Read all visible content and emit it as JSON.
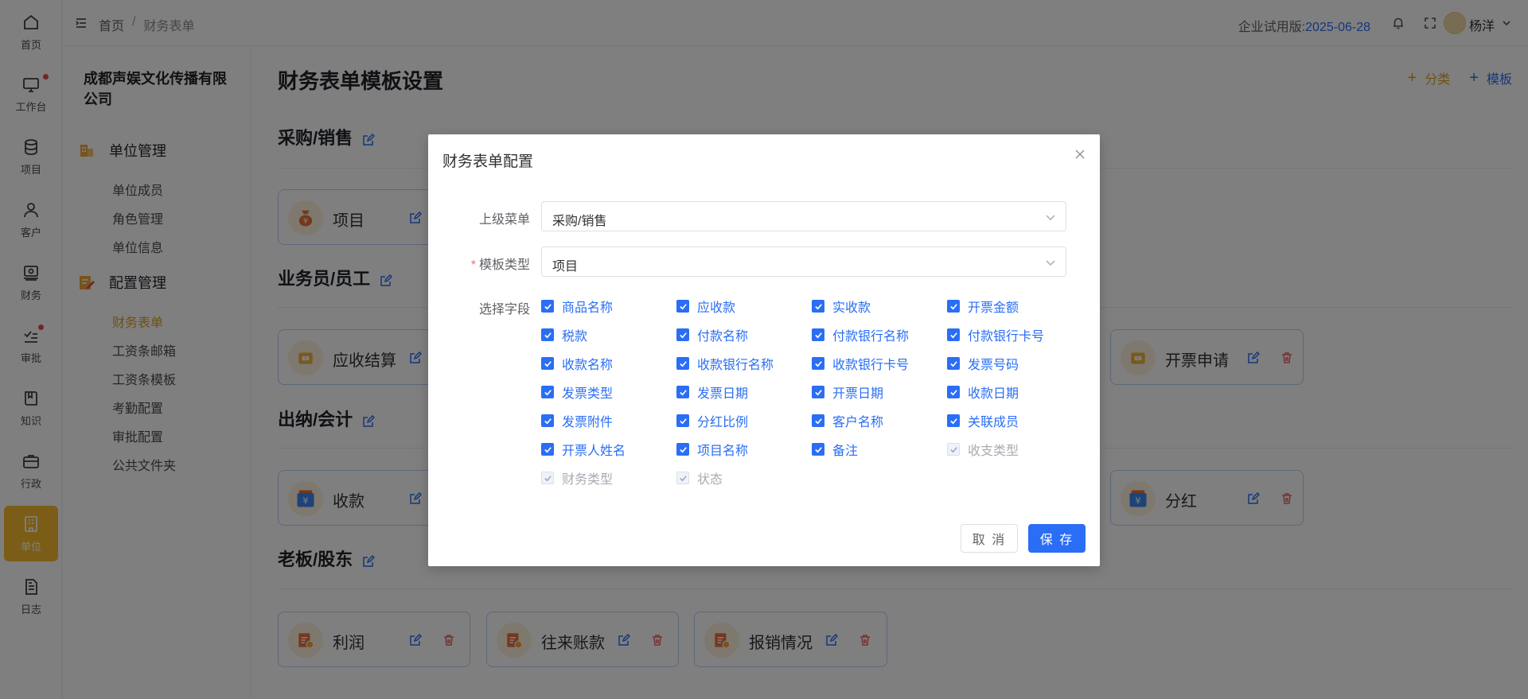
{
  "rail": [
    {
      "label": "首页",
      "icon": "home-icon"
    },
    {
      "label": "工作台",
      "icon": "monitor-icon",
      "dot": true
    },
    {
      "label": "项目",
      "icon": "database-icon"
    },
    {
      "label": "客户",
      "icon": "user-icon"
    },
    {
      "label": "财务",
      "icon": "finance-icon"
    },
    {
      "label": "审批",
      "icon": "approval-icon",
      "dot": true
    },
    {
      "label": "知识",
      "icon": "book-icon"
    },
    {
      "label": "行政",
      "icon": "briefcase-icon"
    },
    {
      "label": "单位",
      "icon": "building-icon",
      "active": true
    },
    {
      "label": "日志",
      "icon": "document-icon"
    }
  ],
  "header": {
    "breadcrumb": [
      "首页",
      "/",
      "财务表单"
    ],
    "trial_label": "企业试用版:",
    "trial_date": "2025-06-28",
    "username": "杨洋"
  },
  "subnav": {
    "company": "成都声娱文化传播有限公司",
    "groups": [
      {
        "title": "单位管理",
        "items": [
          "单位成员",
          "角色管理",
          "单位信息"
        ]
      },
      {
        "title": "配置管理",
        "items": [
          "财务表单",
          "工资条邮箱",
          "工资条模板",
          "考勤配置",
          "审批配置",
          "公共文件夹"
        ]
      }
    ],
    "active_item": "财务表单"
  },
  "main": {
    "title": "财务表单模板设置",
    "actions": {
      "category": "分类",
      "template": "模板"
    },
    "sections": [
      {
        "title": "采购/销售",
        "cards": [
          "项目"
        ]
      },
      {
        "title": "业务员/员工",
        "cards": [
          "应收结算",
          "开票申请"
        ]
      },
      {
        "title": "出纳/会计",
        "cards": [
          "收款",
          "分红"
        ]
      },
      {
        "title": "老板/股东",
        "cards": [
          "利润",
          "往来账款",
          "报销情况"
        ]
      }
    ]
  },
  "dialog": {
    "title": "财务表单配置",
    "parent_menu_label": "上级菜单",
    "parent_menu_value": "采购/销售",
    "template_type_label": "模板类型",
    "template_type_value": "项目",
    "fields_label": "选择字段",
    "fields": [
      {
        "label": "商品名称",
        "checked": true,
        "disabled": false
      },
      {
        "label": "应收款",
        "checked": true,
        "disabled": false
      },
      {
        "label": "实收款",
        "checked": true,
        "disabled": false
      },
      {
        "label": "开票金额",
        "checked": true,
        "disabled": false
      },
      {
        "label": "税款",
        "checked": true,
        "disabled": false
      },
      {
        "label": "付款名称",
        "checked": true,
        "disabled": false
      },
      {
        "label": "付款银行名称",
        "checked": true,
        "disabled": false
      },
      {
        "label": "付款银行卡号",
        "checked": true,
        "disabled": false
      },
      {
        "label": "收款名称",
        "checked": true,
        "disabled": false
      },
      {
        "label": "收款银行名称",
        "checked": true,
        "disabled": false
      },
      {
        "label": "收款银行卡号",
        "checked": true,
        "disabled": false
      },
      {
        "label": "发票号码",
        "checked": true,
        "disabled": false
      },
      {
        "label": "发票类型",
        "checked": true,
        "disabled": false
      },
      {
        "label": "发票日期",
        "checked": true,
        "disabled": false
      },
      {
        "label": "开票日期",
        "checked": true,
        "disabled": false
      },
      {
        "label": "收款日期",
        "checked": true,
        "disabled": false
      },
      {
        "label": "发票附件",
        "checked": true,
        "disabled": false
      },
      {
        "label": "分红比例",
        "checked": true,
        "disabled": false
      },
      {
        "label": "客户名称",
        "checked": true,
        "disabled": false
      },
      {
        "label": "关联成员",
        "checked": true,
        "disabled": false
      },
      {
        "label": "开票人姓名",
        "checked": true,
        "disabled": false
      },
      {
        "label": "项目名称",
        "checked": true,
        "disabled": false
      },
      {
        "label": "备注",
        "checked": true,
        "disabled": false
      },
      {
        "label": "收支类型",
        "checked": true,
        "disabled": true
      },
      {
        "label": "财务类型",
        "checked": true,
        "disabled": true
      },
      {
        "label": "状态",
        "checked": true,
        "disabled": true
      }
    ],
    "cancel_label": "取 消",
    "save_label": "保 存"
  },
  "colors": {
    "primary": "#2a6ef5",
    "accent": "#f6bb2e",
    "danger": "#f06262"
  }
}
